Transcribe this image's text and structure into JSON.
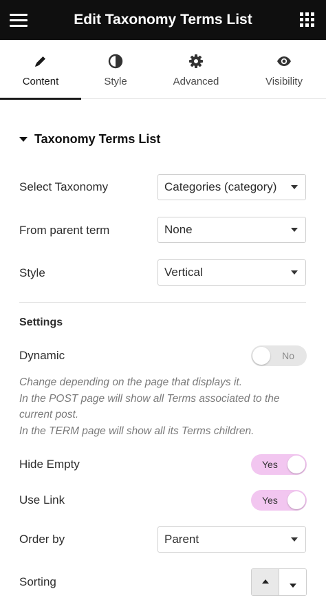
{
  "header": {
    "title": "Edit Taxonomy Terms List",
    "menu_icon": "hamburger-menu-icon",
    "apps_icon": "grid-apps-icon"
  },
  "tabs": [
    {
      "label": "Content",
      "icon": "pencil-icon",
      "active": true
    },
    {
      "label": "Style",
      "icon": "half-circle-icon",
      "active": false
    },
    {
      "label": "Advanced",
      "icon": "gear-icon",
      "active": false
    },
    {
      "label": "Visibility",
      "icon": "eye-icon",
      "active": false
    }
  ],
  "section": {
    "title": "Taxonomy Terms List",
    "fields": {
      "select_taxonomy": {
        "label": "Select Taxonomy",
        "value": "Categories (category)"
      },
      "from_parent_term": {
        "label": "From parent term",
        "value": "None"
      },
      "style": {
        "label": "Style",
        "value": "Vertical"
      }
    }
  },
  "settings": {
    "title": "Settings",
    "dynamic": {
      "label": "Dynamic",
      "value": "No",
      "enabled": false
    },
    "help_lines": [
      "Change depending on the page that displays it.",
      "In the POST page will show all Terms associated to the current post.",
      "In the TERM page will show all its Terms children."
    ],
    "hide_empty": {
      "label": "Hide Empty",
      "value": "Yes",
      "enabled": true
    },
    "use_link": {
      "label": "Use Link",
      "value": "Yes",
      "enabled": true
    },
    "order_by": {
      "label": "Order by",
      "value": "Parent"
    },
    "sorting": {
      "label": "Sorting",
      "selected": "ascending"
    }
  },
  "colors": {
    "header_bg": "#0f0f0f",
    "toggle_on": "#f2c6f0",
    "toggle_off": "#e6e6e6"
  }
}
